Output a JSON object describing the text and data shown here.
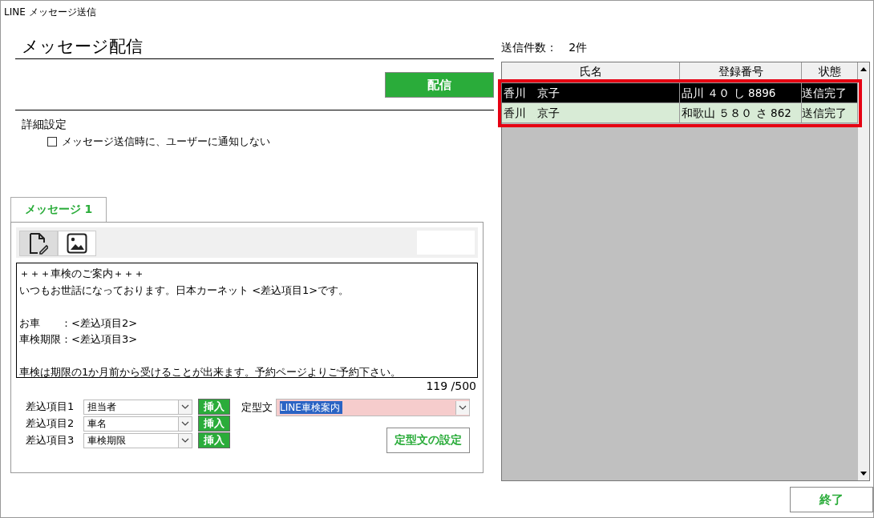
{
  "window": {
    "title": "LINE メッセージ送信"
  },
  "heading": "メッセージ配信",
  "send_button": "配信",
  "details": {
    "title": "詳細設定",
    "options": [
      {
        "label": "メッセージ送信時に、ユーザーに通知しない",
        "checked": false
      }
    ]
  },
  "tabs": [
    {
      "label": "メッセージ 1",
      "selected": true
    }
  ],
  "editor_modes": [
    {
      "kind": "text",
      "selected": true
    },
    {
      "kind": "image",
      "selected": false
    }
  ],
  "message_paragraphs": [
    [
      "＋＋＋車検のご案内＋＋＋",
      "いつもお世話になっております。日本カーネット <差込項目1>です。"
    ],
    [
      "お車　　：<差込項目2>",
      "車検期限：<差込項目3>"
    ],
    [
      "車検は期限の1か月前から受けることが出来ます。予約ページよりご予約下さい。"
    ]
  ],
  "counter": "119 /500",
  "insert_fields": [
    {
      "label": "差込項目1",
      "value": "担当者",
      "button": "挿入"
    },
    {
      "label": "差込項目2",
      "value": "車名",
      "button": "挿入"
    },
    {
      "label": "差込項目3",
      "value": "車検期限",
      "button": "挿入"
    }
  ],
  "template": {
    "label": "定型文",
    "value": "LINE車検案内",
    "settings_button": "定型文の設定"
  },
  "sent_count": {
    "label": "送信件数：",
    "value": "2件"
  },
  "table": {
    "columns": [
      "氏名",
      "登録番号",
      "状態"
    ],
    "rows": [
      {
        "cells": [
          "香川　京子",
          "品川 ４０ し 8896",
          "送信完了"
        ],
        "selected": true
      },
      {
        "cells": [
          "香川　京子",
          "和歌山 ５８０ さ 862",
          "送信完了"
        ],
        "selected": false
      }
    ]
  },
  "close_button": "終了"
}
